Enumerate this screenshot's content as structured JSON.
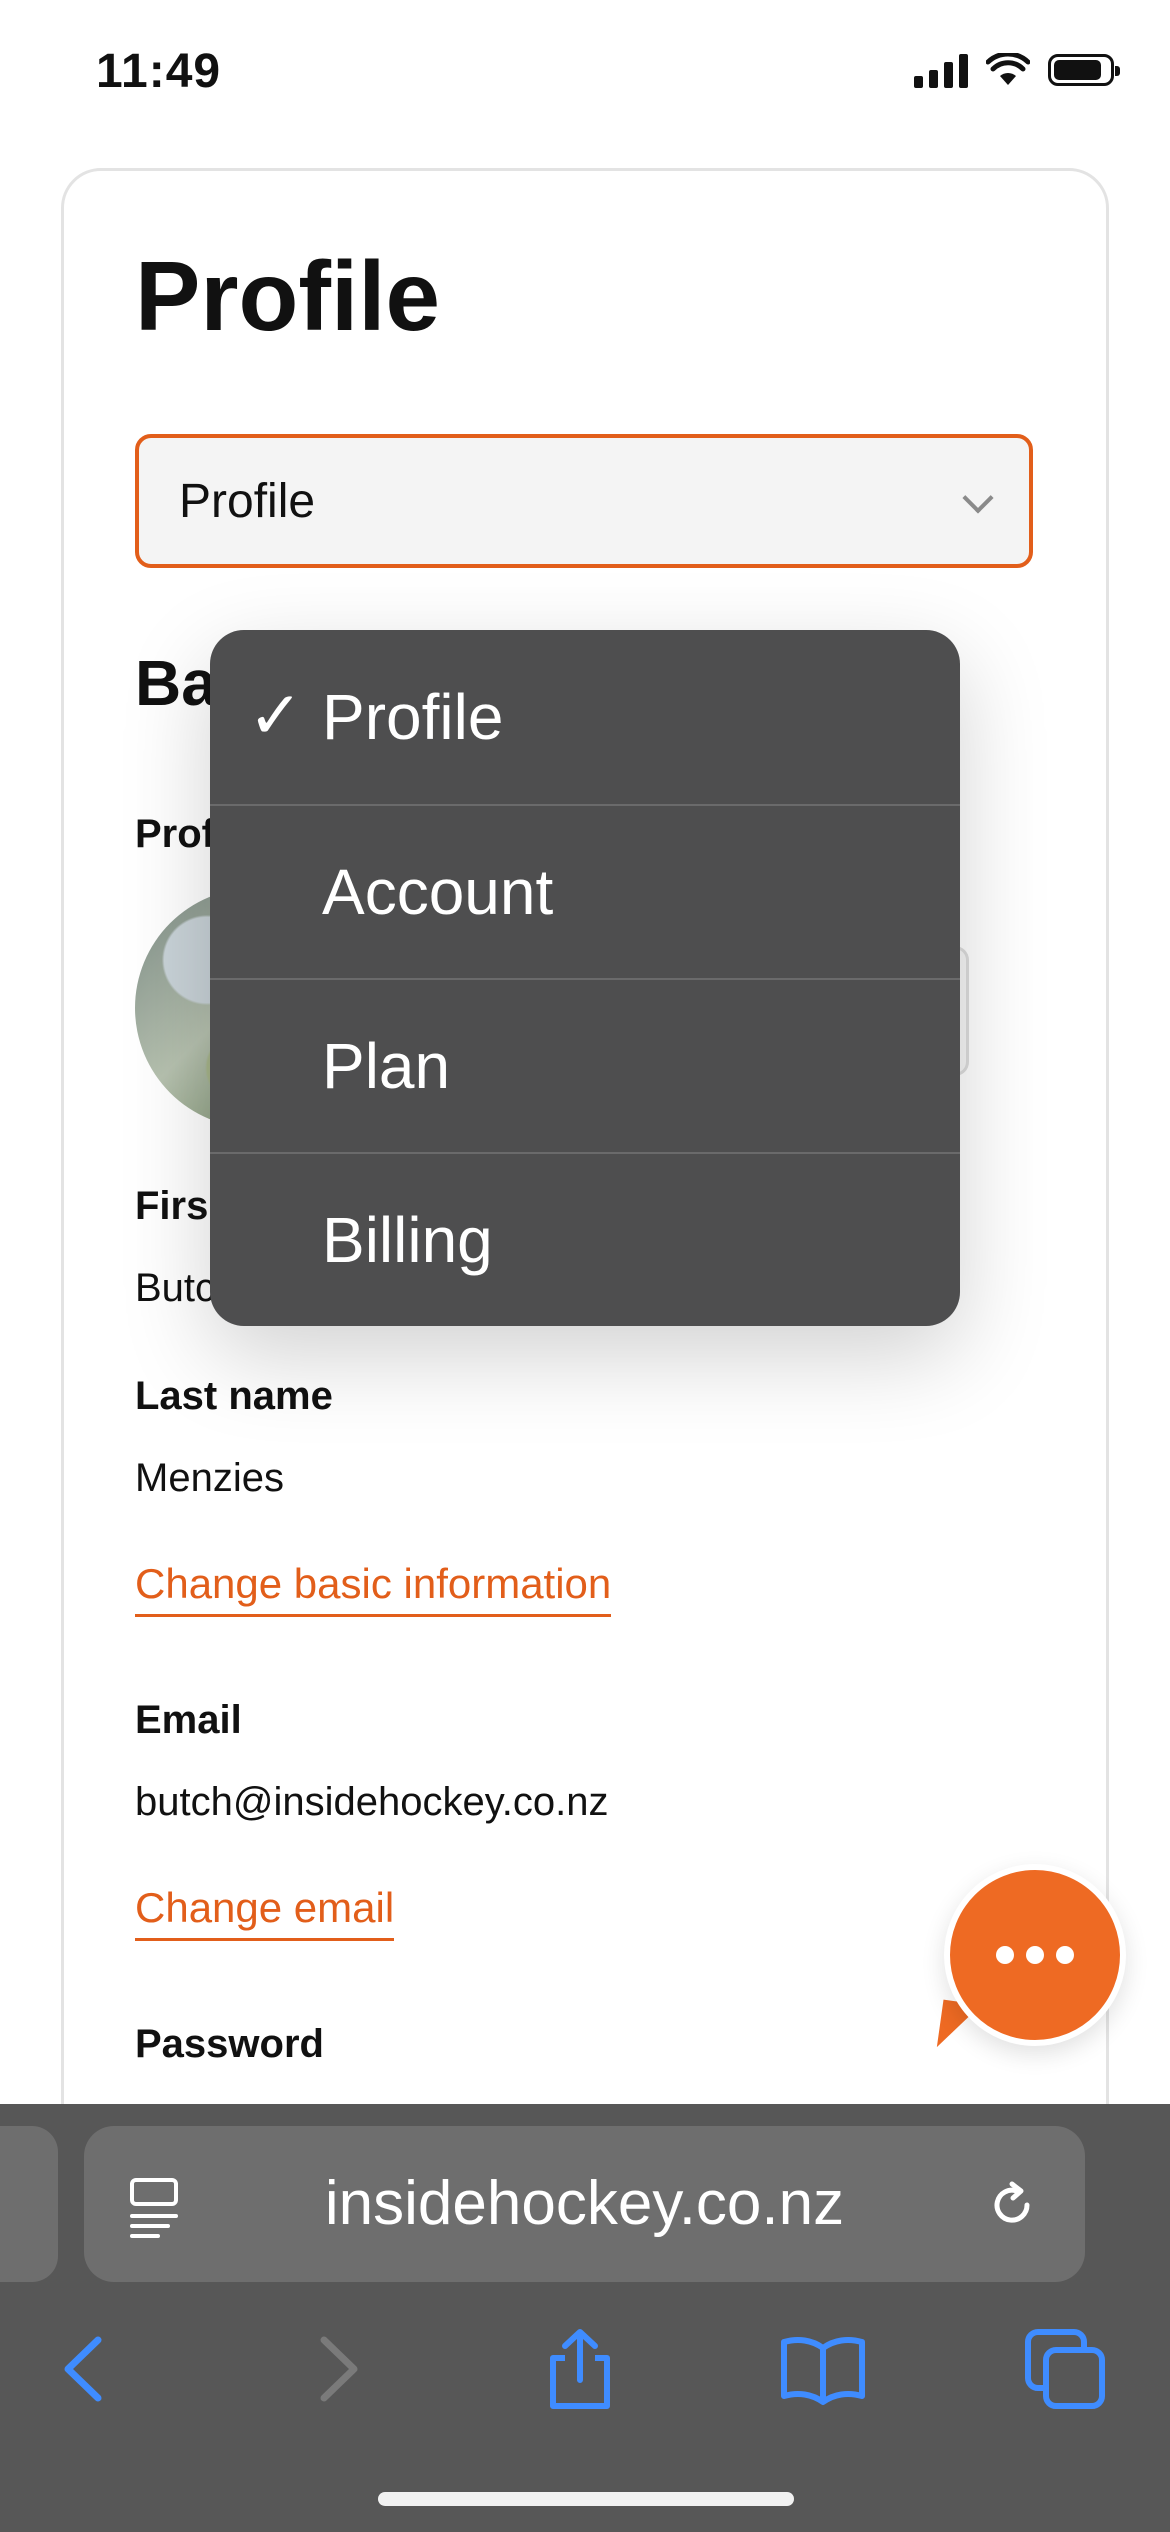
{
  "status_bar": {
    "time": "11:49"
  },
  "page": {
    "title": "Profile",
    "tab_select": {
      "selected": "Profile"
    },
    "section_heading": "Ba",
    "profile_label": "Prof",
    "first_name_label": "Firs",
    "first_name_value": "Butc",
    "last_name_label": "Last name",
    "last_name_value": "Menzies",
    "change_basic_link": "Change basic information",
    "email_label": "Email",
    "email_value": "butch@insidehockey.co.nz",
    "change_email_link": "Change email",
    "password_label": "Password"
  },
  "dropdown": {
    "check_mark": "✓",
    "items": [
      {
        "label": "Profile",
        "checked": true
      },
      {
        "label": "Account",
        "checked": false
      },
      {
        "label": "Plan",
        "checked": false
      },
      {
        "label": "Billing",
        "checked": false
      }
    ]
  },
  "browser": {
    "url": "insidehockey.co.nz"
  },
  "icons": {
    "chat": "chat-bubble-icon",
    "reader": "reader-mode-icon",
    "reload": "reload-icon",
    "back": "back-arrow-icon",
    "forward": "forward-arrow-icon",
    "share": "share-icon",
    "bookmarks": "bookmarks-icon",
    "tabs": "tabs-icon"
  },
  "colors": {
    "accent": "#e25e1a",
    "chat": "#ee6a23",
    "menu_bg": "#4e4e4f",
    "browser_bar": "#575757",
    "toolbar_icon": "#3f8cff"
  }
}
